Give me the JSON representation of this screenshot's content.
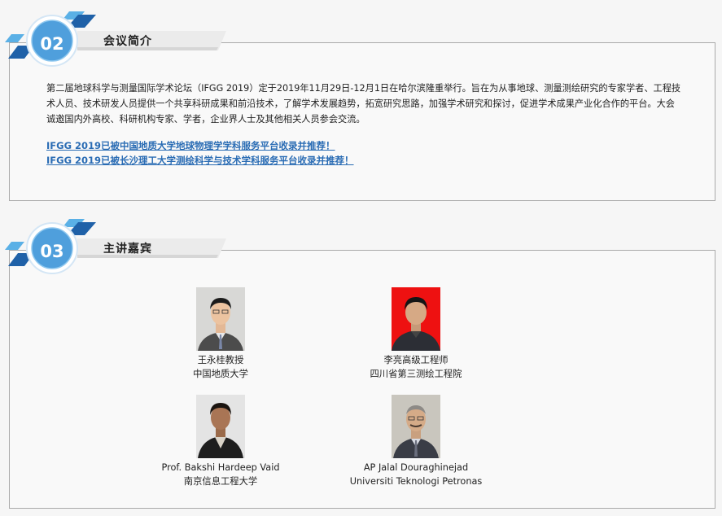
{
  "sections": [
    {
      "number": "02",
      "title": "会议简介",
      "intro": "第二届地球科学与测量国际学术论坛（IFGG 2019）定于2019年11月29日-12月1日在哈尔滨隆重举行。旨在为从事地球、测量测绘研究的专家学者、工程技术人员、技术研发人员提供一个共享科研成果和前沿技术，了解学术发展趋势，拓宽研究思路，加强学术研究和探讨，促进学术成果产业化合作的平台。大会诚邀国内外高校、科研机构专家、学者，企业界人士及其他相关人员参会交流。",
      "links": [
        "IFGG 2019已被中国地质大学地球物理学学科服务平台收录并推荐！",
        "IFGG 2019已被长沙理工大学测绘科学与技术学科服务平台收录并推荐！"
      ]
    },
    {
      "number": "03",
      "title": "主讲嘉宾",
      "speakers": [
        {
          "name": "王永桂教授",
          "org": "中国地质大学"
        },
        {
          "name": "李亮高级工程师",
          "org": "四川省第三测绘工程院"
        },
        {
          "name": "Prof. Bakshi Hardeep Vaid",
          "org": "南京信息工程大学"
        },
        {
          "name": "AP Jalal Douraghinejad",
          "org": "Universiti Teknologi Petronas"
        }
      ]
    }
  ],
  "colors": {
    "accent": "#2a6cb4",
    "badge_light": "#5ab0e6",
    "badge_dark": "#1f61a8",
    "border": "#a9a9a9"
  }
}
